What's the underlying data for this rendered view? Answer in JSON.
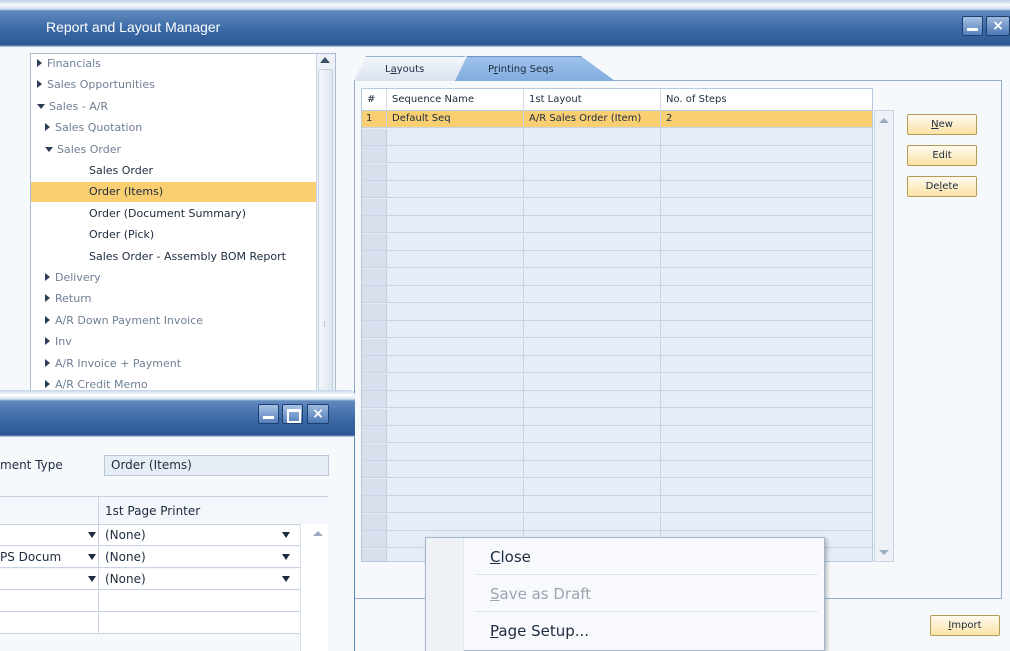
{
  "main_window": {
    "title": "Report and Layout Manager",
    "close_glyph": "×"
  },
  "tree": {
    "items": [
      {
        "label": "Financials",
        "state": "collapsed",
        "level": 0
      },
      {
        "label": "Sales Opportunities",
        "state": "collapsed",
        "level": 0
      },
      {
        "label": "Sales - A/R",
        "state": "expanded",
        "level": 0
      },
      {
        "label": "Sales Quotation",
        "state": "collapsed",
        "level": 1
      },
      {
        "label": "Sales Order",
        "state": "expanded",
        "level": 1
      },
      {
        "label": "Sales Order",
        "state": "leaf",
        "level": 2
      },
      {
        "label": "Order (Items)",
        "state": "leaf",
        "level": 2,
        "selected": true
      },
      {
        "label": "Order (Document Summary)",
        "state": "leaf",
        "level": 2
      },
      {
        "label": "Order (Pick)",
        "state": "leaf",
        "level": 2
      },
      {
        "label": "Sales Order - Assembly BOM Report",
        "state": "leaf",
        "level": 2
      },
      {
        "label": "Delivery",
        "state": "collapsed",
        "level": 1
      },
      {
        "label": "Return",
        "state": "collapsed",
        "level": 1
      },
      {
        "label": "A/R Down Payment Invoice",
        "state": "collapsed",
        "level": 1
      },
      {
        "label": "Inv",
        "state": "collapsed",
        "level": 1
      },
      {
        "label": "A/R Invoice + Payment",
        "state": "collapsed",
        "level": 1
      },
      {
        "label": "A/R Credit Memo",
        "state": "collapsed",
        "level": 1
      }
    ]
  },
  "tabs": [
    {
      "label": "Layouts",
      "underline": "a",
      "rest_pre": "L",
      "rest_post": "youts"
    },
    {
      "label": "Printing Seqs",
      "underline": "r",
      "rest_pre": "P",
      "rest_post": "inting Seqs"
    }
  ],
  "sequence_grid": {
    "columns": [
      "#",
      "Sequence Name",
      "1st Layout",
      "No. of Steps"
    ],
    "rows": [
      {
        "num": "1",
        "name": "Default Seq",
        "layout": "A/R Sales Order (Item)",
        "steps": "2"
      }
    ],
    "empty_rows": 25
  },
  "buttons": {
    "new": {
      "pre": "",
      "u": "N",
      "post": "ew"
    },
    "edit": {
      "label": "Edit"
    },
    "delete": {
      "pre": "De",
      "u": "l",
      "post": "ete"
    },
    "import": {
      "pre": "",
      "u": "I",
      "post": "mport"
    }
  },
  "sub_window": {
    "close_glyph": "×",
    "doc_type_label": "ment Type",
    "doc_type_value": "Order (Items)",
    "grid_header": "1st Page Printer",
    "rows": [
      {
        "left": "",
        "printer": "(None)",
        "left_dropdown": true,
        "right_dropdown": true
      },
      {
        "left": "PS Docum",
        "printer": "(None)",
        "left_dropdown": true,
        "right_dropdown": true
      },
      {
        "left": "",
        "printer": "(None)",
        "left_dropdown": true,
        "right_dropdown": true
      },
      {
        "left": "",
        "printer": "",
        "left_dropdown": false,
        "right_dropdown": false
      },
      {
        "left": "",
        "printer": "",
        "left_dropdown": false,
        "right_dropdown": false
      }
    ]
  },
  "context_menu": {
    "items": [
      {
        "pre": "",
        "u": "C",
        "post": "lose",
        "disabled": false
      },
      {
        "pre": "",
        "u": "S",
        "post": "ave as Draft",
        "disabled": true
      },
      {
        "pre": "",
        "u": "P",
        "post": "age Setup...",
        "disabled": false
      }
    ]
  }
}
